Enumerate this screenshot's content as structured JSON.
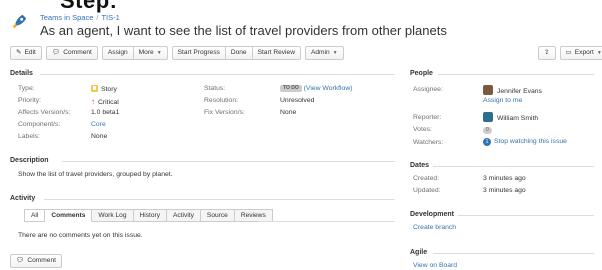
{
  "overflow_title": "Step:",
  "breadcrumb": {
    "project": "Teams in Space",
    "separator": "/",
    "issue_key": "TIS-1"
  },
  "issue": {
    "summary": "As an agent, I want to see the list of travel providers from other planets"
  },
  "toolbar": {
    "edit": "Edit",
    "comment": "Comment",
    "assign": "Assign",
    "more": "More",
    "start_progress": "Start Progress",
    "done": "Done",
    "start_review": "Start Review",
    "admin": "Admin",
    "export": "Export"
  },
  "details": {
    "heading": "Details",
    "type_label": "Type:",
    "type_value": "Story",
    "priority_label": "Priority:",
    "priority_value": "Critical",
    "affects_label": "Affects Version/s:",
    "affects_value": "1.0 beta1",
    "components_label": "Component/s:",
    "components_value": "Core",
    "labels_label": "Labels:",
    "labels_value": "None",
    "status_label": "Status:",
    "status_value": "TO DO",
    "view_workflow": "(View Workflow)",
    "resolution_label": "Resolution:",
    "resolution_value": "Unresolved",
    "fix_label": "Fix Version/s:",
    "fix_value": "None"
  },
  "description": {
    "heading": "Description",
    "text": "Show the list of travel providers, grouped by planet."
  },
  "activity": {
    "heading": "Activity",
    "tabs": [
      "All",
      "Comments",
      "Work Log",
      "History",
      "Activity",
      "Source",
      "Reviews"
    ],
    "active_tab": "Comments",
    "empty_text": "There are no comments yet on this issue.",
    "comment_button": "Comment"
  },
  "people": {
    "heading": "People",
    "assignee_label": "Assignee:",
    "assignee_value": "Jennifer Evans",
    "assign_to_me": "Assign to me",
    "reporter_label": "Reporter:",
    "reporter_value": "William Smith",
    "votes_label": "Votes:",
    "votes_value": "0",
    "watchers_label": "Watchers:",
    "watchers_count": "1",
    "watchers_link": "Stop watching this issue"
  },
  "dates": {
    "heading": "Dates",
    "created_label": "Created:",
    "created_value": "3 minutes ago",
    "updated_label": "Updated:",
    "updated_value": "3 minutes ago"
  },
  "development": {
    "heading": "Development",
    "create_branch": "Create branch"
  },
  "agile": {
    "heading": "Agile",
    "view_on_board": "View on Board"
  },
  "colors": {
    "link": "#3572b0",
    "critical": "#d04437",
    "story": "#f3c94d"
  }
}
